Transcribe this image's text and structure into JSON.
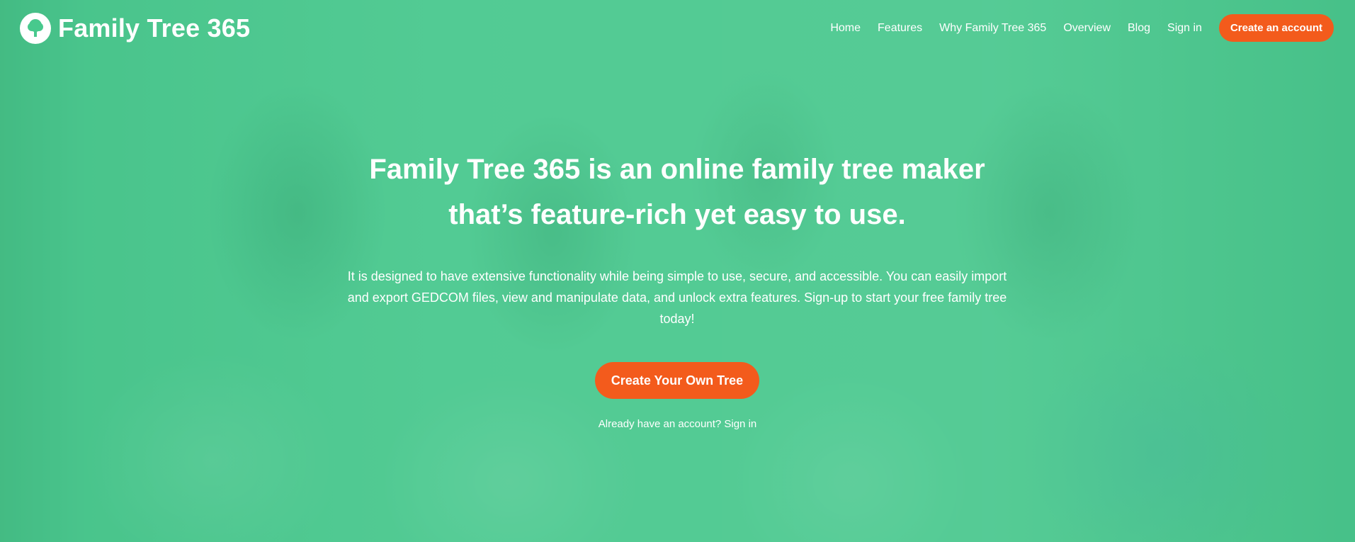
{
  "brand": {
    "name": "Family Tree 365",
    "logo_icon": "tree-icon",
    "accent_color": "#f35b1c",
    "overlay_color": "#48c98d"
  },
  "nav": {
    "items": [
      {
        "label": "Home"
      },
      {
        "label": "Features"
      },
      {
        "label": "Why Family Tree 365"
      },
      {
        "label": "Overview"
      },
      {
        "label": "Blog"
      },
      {
        "label": "Sign in"
      }
    ],
    "cta_label": "Create an account"
  },
  "hero": {
    "headline_line1": "Family Tree 365 is an online family tree maker",
    "headline_line2": "that’s feature-rich yet easy to use.",
    "description": "It is designed to have extensive functionality while being simple to use, secure, and accessible. You can easily import and export GEDCOM files, view and manipulate data, and unlock extra features. Sign-up to start your free family tree today!",
    "primary_button": "Create Your Own Tree",
    "signin_prompt": "Already have an account?",
    "signin_link": "Sign in"
  }
}
